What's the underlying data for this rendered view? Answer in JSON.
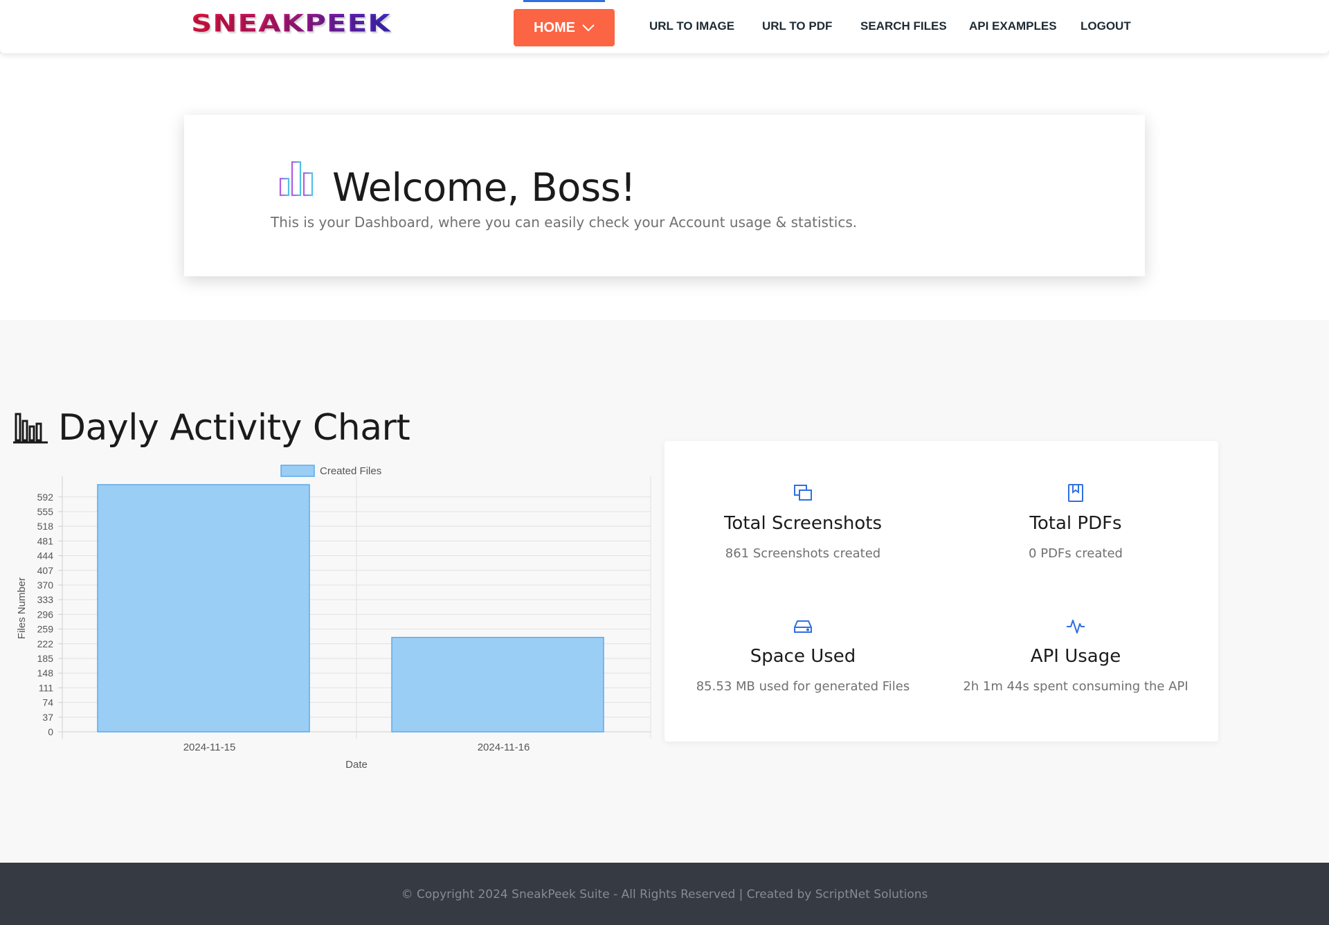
{
  "header": {
    "logo_text": "SNEAKPEEK",
    "nav": {
      "home": "HOME",
      "url_to_image": "URL TO IMAGE",
      "url_to_pdf": "URL TO PDF",
      "search_files": "SEARCH FILES",
      "api_examples": "API EXAMPLES",
      "logout": "LOGOUT"
    }
  },
  "welcome": {
    "title": "Welcome, Boss!",
    "subtitle": "This is your Dashboard, where you can easily check your Account usage & statistics."
  },
  "activity": {
    "heading": "Dayly Activity Chart"
  },
  "chart_data": {
    "type": "bar",
    "categories": [
      "2024-11-15",
      "2024-11-16"
    ],
    "series": [
      {
        "name": "Created Files",
        "values": [
          623,
          238
        ]
      }
    ],
    "xlabel": "Date",
    "ylabel": "Files Number",
    "yticks": [
      0,
      37,
      74,
      111,
      148,
      185,
      222,
      259,
      296,
      333,
      370,
      407,
      444,
      481,
      518,
      555,
      592
    ],
    "ylim": [
      0,
      623
    ],
    "grid": true,
    "legend": "top-center",
    "colors": {
      "fill": "#9bcef5",
      "stroke": "#5aaaea"
    }
  },
  "stats": [
    {
      "icon": "screenshots-icon",
      "title": "Total Screenshots",
      "desc": "861 Screenshots created"
    },
    {
      "icon": "pdf-bookmark-icon",
      "title": "Total PDFs",
      "desc": "0 PDFs created"
    },
    {
      "icon": "hard-drive-icon",
      "title": "Space Used",
      "desc": "85.53 MB used for generated Files"
    },
    {
      "icon": "activity-pulse-icon",
      "title": "API Usage",
      "desc": "2h 1m 44s spent consuming the API"
    }
  ],
  "footer": {
    "text": "© Copyright 2024 SneakPeek Suite - All Rights Reserved | Created by ScriptNet Solutions"
  },
  "colors": {
    "accent": "#fb6544",
    "nav_indicator": "#2f6fe0",
    "icon_blue": "#2f6fe0",
    "footer_bg": "#363a42"
  }
}
